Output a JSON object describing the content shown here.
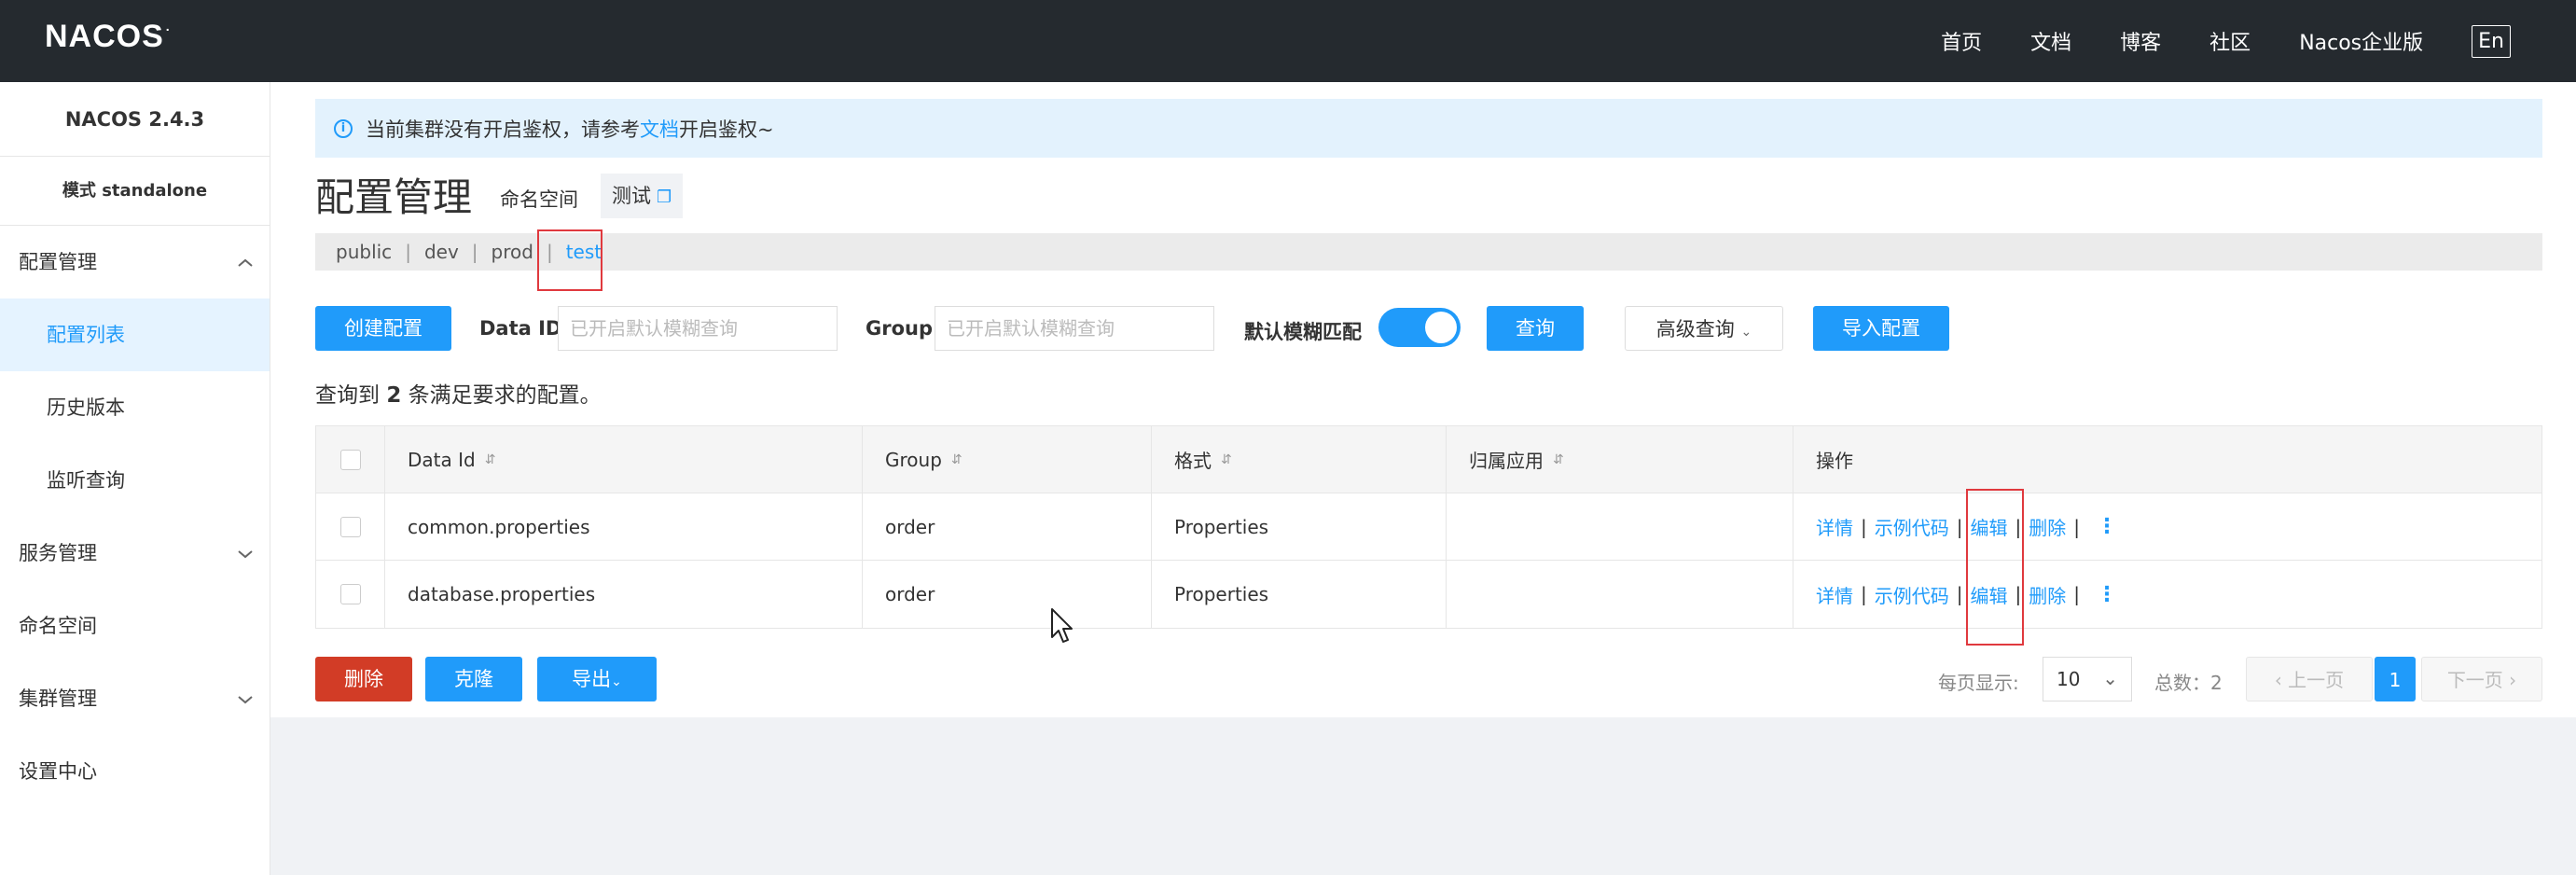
{
  "topbar": {
    "logo": "NACOS",
    "logo_mark": ".",
    "nav": [
      "首页",
      "文档",
      "博客",
      "社区",
      "Nacos企业版"
    ],
    "lang": "En"
  },
  "sidebar": {
    "version": "NACOS 2.4.3",
    "mode": "模式 standalone",
    "items": [
      {
        "label": "配置管理",
        "expandable": true
      },
      {
        "label": "配置列表",
        "active": true
      },
      {
        "label": "历史版本"
      },
      {
        "label": "监听查询"
      },
      {
        "label": "服务管理",
        "expandable": true
      },
      {
        "label": "命名空间"
      },
      {
        "label": "集群管理",
        "expandable": true
      },
      {
        "label": "设置中心"
      }
    ]
  },
  "notice": {
    "prefix": "当前集群没有开启鉴权，请参考",
    "link": "文档",
    "suffix": "开启鉴权~"
  },
  "page": {
    "title": "配置管理",
    "ns_label": "命名空间",
    "ns_current": "测试"
  },
  "namespaces": [
    {
      "name": "public"
    },
    {
      "name": "dev"
    },
    {
      "name": "prod"
    },
    {
      "name": "test",
      "active": true
    }
  ],
  "search": {
    "create_btn": "创建配置",
    "dataid_label": "Data ID",
    "dataid_placeholder": "已开启默认模糊查询",
    "group_label": "Group",
    "group_placeholder": "已开启默认模糊查询",
    "fuzzy_label": "默认模糊匹配",
    "fuzzy_on": true,
    "query_btn": "查询",
    "advanced_btn": "高级查询",
    "import_btn": "导入配置"
  },
  "result": {
    "prefix": "查询到 ",
    "count": "2",
    "suffix": " 条满足要求的配置。"
  },
  "table": {
    "headers": [
      "Data Id",
      "Group",
      "格式",
      "归属应用",
      "操作"
    ],
    "rows": [
      {
        "data_id": "common.properties",
        "group": "order",
        "format": "Properties",
        "app": ""
      },
      {
        "data_id": "database.properties",
        "group": "order",
        "format": "Properties",
        "app": ""
      }
    ],
    "ops": [
      "详情",
      "示例代码",
      "编辑",
      "删除"
    ]
  },
  "bottom": {
    "delete_btn": "删除",
    "clone_btn": "克隆",
    "export_btn": "导出",
    "page_size_label": "每页显示:",
    "page_size": "10",
    "total_label": "总数：2",
    "prev": "上一页",
    "page": "1",
    "next": "下一页"
  },
  "colors": {
    "primary": "#209bfa",
    "danger": "#d23c26",
    "topbar": "#252a2f",
    "highlight_box": "#e0393e"
  }
}
